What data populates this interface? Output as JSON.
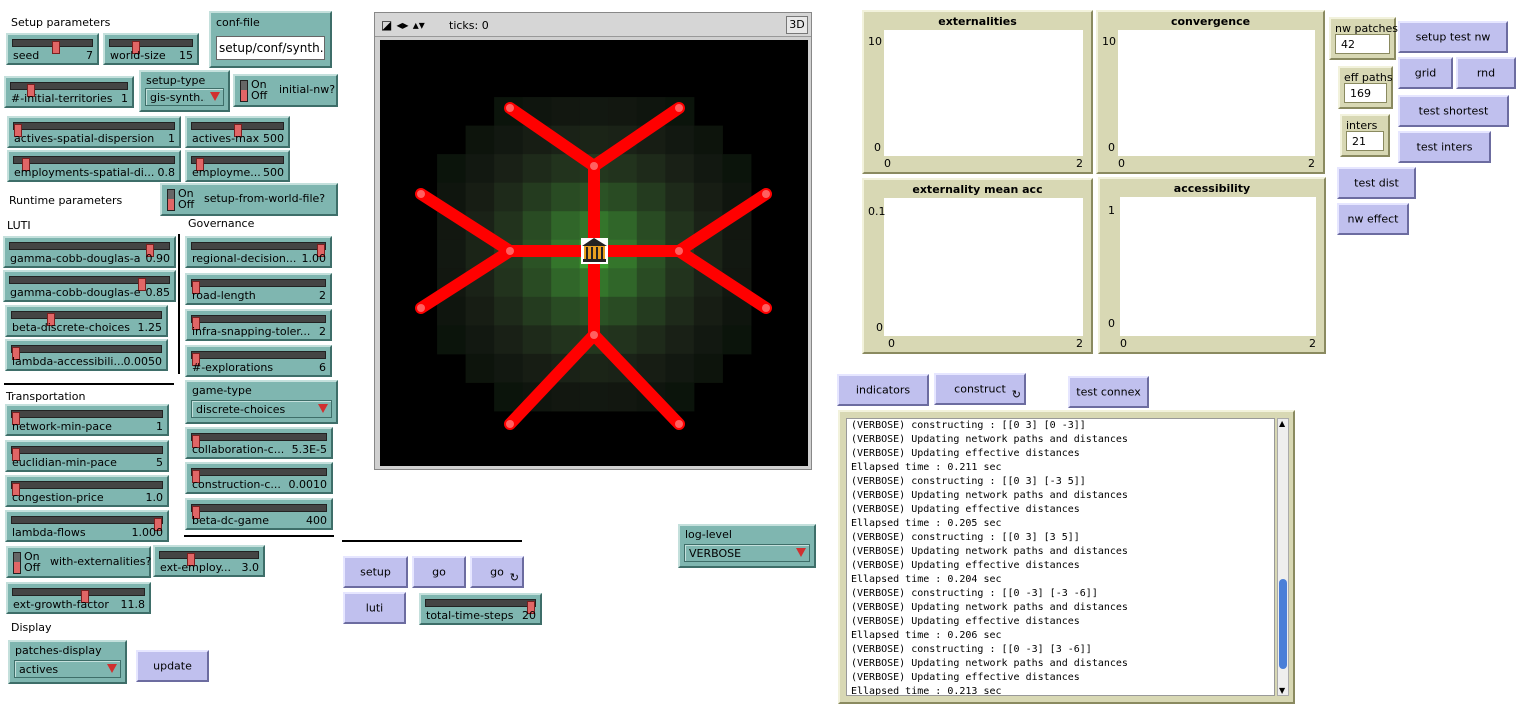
{
  "sections": {
    "setup_parameters": "Setup parameters",
    "runtime_parameters": "Runtime parameters",
    "luti": "LUTI",
    "governance": "Governance",
    "transportation": "Transportation",
    "display": "Display"
  },
  "sliders": {
    "seed": {
      "name": "seed",
      "value": "7",
      "pos": 0.55
    },
    "world_size": {
      "name": "world-size",
      "value": "15",
      "pos": 0.3
    },
    "initial_territories": {
      "name": "#-initial-territories",
      "value": "1",
      "pos": 0.15
    },
    "actives_spatial_dispersion": {
      "name": "actives-spatial-dispersion",
      "value": "1",
      "pos": 0.0
    },
    "actives_max": {
      "name": "actives-max",
      "value": "500",
      "pos": 0.5
    },
    "employments_spatial_di": {
      "name": "employments-spatial-di...",
      "value": "0.8",
      "pos": 0.05
    },
    "employments_max": {
      "name": "employme...",
      "value": "500",
      "pos": 0.05
    },
    "gamma_cobb_douglas_a": {
      "name": "gamma-cobb-douglas-a",
      "value": "0.90",
      "pos": 0.9
    },
    "gamma_cobb_douglas_e": {
      "name": "gamma-cobb-douglas-e",
      "value": "0.85",
      "pos": 0.85
    },
    "beta_discrete_choices": {
      "name": "beta-discrete-choices",
      "value": "1.25",
      "pos": 0.25
    },
    "lambda_accessibility": {
      "name": "lambda-accessibili...",
      "value": "0.0050",
      "pos": 0.0
    },
    "regional_decision": {
      "name": "regional-decision...",
      "value": "1.00",
      "pos": 1.0
    },
    "road_length": {
      "name": "road-length",
      "value": "2",
      "pos": 0.0
    },
    "infra_snapping": {
      "name": "infra-snapping-toler...",
      "value": "2",
      "pos": 0.0
    },
    "explorations": {
      "name": "#-explorations",
      "value": "6",
      "pos": 0.0
    },
    "network_min_pace": {
      "name": "network-min-pace",
      "value": "1",
      "pos": 0.0
    },
    "euclidian_min_pace": {
      "name": "euclidian-min-pace",
      "value": "5",
      "pos": 0.0
    },
    "congestion_price": {
      "name": "congestion-price",
      "value": "1.0",
      "pos": 0.0
    },
    "lambda_flows": {
      "name": "lambda-flows",
      "value": "1.000",
      "pos": 1.0
    },
    "collaboration": {
      "name": "collaboration-c...",
      "value": "5.3E-5",
      "pos": 0.0
    },
    "construction": {
      "name": "construction-c...",
      "value": "0.0010",
      "pos": 0.0
    },
    "beta_dc_game": {
      "name": "beta-dc-game",
      "value": "400",
      "pos": 0.0
    },
    "ext_employ": {
      "name": "ext-employ...",
      "value": "3.0",
      "pos": 0.3
    },
    "ext_growth_factor": {
      "name": "ext-growth-factor",
      "value": "11.8",
      "pos": 0.55
    },
    "total_time_steps": {
      "name": "total-time-steps",
      "value": "20",
      "pos": 1.0
    }
  },
  "conf_file": {
    "name": "conf-file",
    "value": "setup/conf/synth.c"
  },
  "choosers": {
    "setup_type": {
      "name": "setup-type",
      "value": "gis-synth..."
    },
    "game_type": {
      "name": "game-type",
      "value": "discrete-choices"
    },
    "patches_display": {
      "name": "patches-display",
      "value": "actives"
    },
    "log_level": {
      "name": "log-level",
      "value": "VERBOSE"
    }
  },
  "switches": {
    "on": "On",
    "off": "Off",
    "initial_nw": "initial-nw?",
    "setup_from_world_file": "setup-from-world-file?",
    "with_externalities": "with-externalities?"
  },
  "buttons": {
    "update": "update",
    "setup": "setup",
    "go": "go",
    "go_forever": "go",
    "luti": "luti",
    "indicators": "indicators",
    "construct": "construct",
    "test_connex": "test connex",
    "setup_test_nw": "setup test nw",
    "grid": "grid",
    "rnd": "rnd",
    "test_shortest": "test shortest",
    "test_inters": "test inters",
    "test_dist": "test dist",
    "nw_effect": "nw effect",
    "forever_glyph": "↻"
  },
  "view": {
    "ticks": "ticks: 0",
    "three_d": "3D"
  },
  "monitors": {
    "nw_patches": {
      "name": "nw patches",
      "value": "42"
    },
    "eff_paths": {
      "name": "eff paths",
      "value": "169"
    },
    "inters": {
      "name": "inters",
      "value": "21"
    }
  },
  "plots": [
    {
      "title": "externalities",
      "ymax": "10",
      "ymin": "0",
      "xmin": "0",
      "xmax": "2"
    },
    {
      "title": "convergence",
      "ymax": "10",
      "ymin": "0",
      "xmin": "0",
      "xmax": "2"
    },
    {
      "title": "externality mean acc",
      "ymax": "0.1",
      "ymin": "0",
      "xmin": "0",
      "xmax": "2"
    },
    {
      "title": "accessibility",
      "ymax": "1",
      "ymin": "0",
      "xmin": "0",
      "xmax": "2"
    }
  ],
  "output_lines": [
    "(VERBOSE) constructing : [[0 3] [0 -3]]",
    "(VERBOSE) Updating network paths and distances",
    "(VERBOSE) Updating effective distances",
    "Ellapsed time : 0.211 sec",
    "(VERBOSE) constructing : [[0 3] [-3 5]]",
    "(VERBOSE) Updating network paths and distances",
    "(VERBOSE) Updating effective distances",
    "Ellapsed time : 0.205 sec",
    "(VERBOSE) constructing : [[0 3] [3 5]]",
    "(VERBOSE) Updating network paths and distances",
    "(VERBOSE) Updating effective distances",
    "Ellapsed time : 0.204 sec",
    "(VERBOSE) constructing : [[0 -3] [-3 -6]]",
    "(VERBOSE) Updating network paths and distances",
    "(VERBOSE) Updating effective distances",
    "Ellapsed time : 0.206 sec",
    "(VERBOSE) constructing : [[0 -3] [3 -6]]",
    "(VERBOSE) Updating network paths and distances",
    "(VERBOSE) Updating effective distances",
    "Ellapsed time : 0.213 sec"
  ],
  "colors": {
    "slider": "#7fb6b0",
    "button": "#c0c0ee",
    "monitor": "#d8d8b4",
    "road": "#ff0000",
    "patch": "#3d8a2a"
  }
}
